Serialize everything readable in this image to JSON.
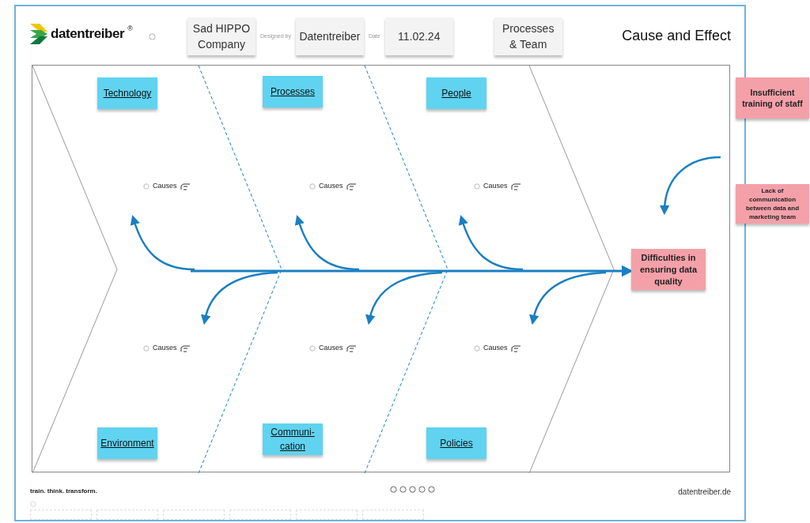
{
  "header": {
    "logo": "datentreiber",
    "logo_mark": "®",
    "fields": [
      {
        "value": "Sad HIPPO Company"
      },
      {
        "label": "Designed by",
        "value": "Datentreiber"
      },
      {
        "label": "Date",
        "value": "11.02.24"
      },
      {
        "value": "Processes & Team"
      }
    ],
    "title": "Cause and Effect"
  },
  "diagram": {
    "top_categories": [
      "Technology",
      "Processes",
      "People"
    ],
    "bottom_categories": [
      "Environment",
      "Communi-cation",
      "Policies"
    ],
    "causes": [
      "Causes",
      "Causes",
      "Causes",
      "Causes",
      "Causes",
      "Causes"
    ],
    "effect": "Difficulties in ensuring data quality"
  },
  "side_notes": [
    "Insufficient training of staff",
    "Lack of communication between data and marketing team"
  ],
  "footer": {
    "slogan": "train. think. transform.",
    "website": "datentreiber.de"
  }
}
